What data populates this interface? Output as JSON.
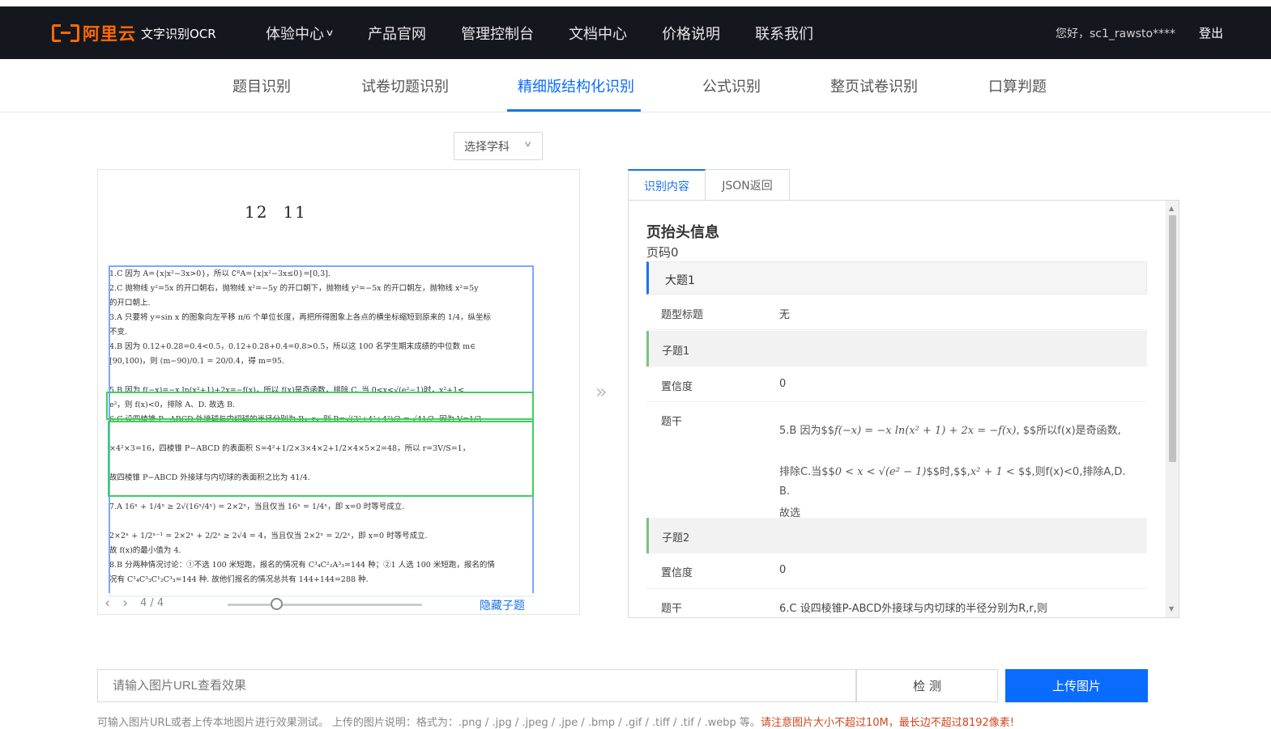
{
  "header": {
    "brand": "阿里云",
    "product": "文字识别OCR",
    "nav": [
      "体验中心",
      "产品官网",
      "管理控制台",
      "文档中心",
      "价格说明",
      "联系我们"
    ],
    "greeting": "您好，sc1_rawsto****",
    "logout": "登出"
  },
  "tabs": [
    "题目识别",
    "试卷切题识别",
    "精细版结构化识别",
    "公式识别",
    "整页试卷识别",
    "口算判题"
  ],
  "active_tab": "精细版结构化识别",
  "subject_select": "选择学科",
  "image_panel": {
    "page_title_left": "12",
    "page_title_right": "11",
    "doc_lines": [
      "1.C  因为 A={x|x²−3x>0}，所以 ∁ᴿA={x|x²−3x≤0}=[0,3].",
      "2.C  抛物线 y²=5x 的开口朝右，抛物线 x²=−5y 的开口朝下，抛物线 y²=−5x 的开口朝左，抛物线 x²=5y",
      "   的开口朝上.",
      "3.A  只要将 y=sin x 的图象向左平移 π/6 个单位长度，再把所得图象上各点的横坐标缩短到原来的 1/4，纵坐标",
      "   不变.",
      "4.B  因为 0.12+0.28=0.4<0.5，0.12+0.28+0.4=0.8>0.5，所以这 100 名学生期末成绩的中位数 m∈",
      "   [90,100)，则 (m−90)/0.1 = 20/0.4，得 m=95.",
      "",
      "5.B  因为 f(−x)=−x ln(x²+1)+2x=−f(x)，所以 f(x)是奇函数，排除 C. 当 0<x<√(e²−1)时，x²+1<",
      "   e²，则 f(x)<0，排除 A、D. 故选 B.",
      "6.C  设四棱锥 P−ABCD 外接球与内切球的半径分别为 R，r，则 R=√(3²+4²+4²)/2 = √41/2. 因为 V=1/3",
      "",
      "   ×4²×3=16，四棱锥 P−ABCD 的表面积 S=4²+1/2×3×4×2+1/2×4×5×2=48，所以 r=3V/S=1，",
      "",
      "   故四棱锥 P−ABCD 外接球与内切球的表面积之比为 41/4.",
      "",
      "7.A  16ˣ + 1/4ˣ ≥ 2√(16ˣ/4ˣ) = 2×2ˣ，当且仅当 16ˣ = 1/4ˣ，即 x=0 时等号成立.",
      "",
      "   2×2ˣ + 1/2ˣ⁻¹ = 2×2ˣ + 2/2ˣ ≥ 2√4 = 4，当且仅当 2×2ˣ = 2/2ˣ，即 x=0 时等号成立.",
      "   故 f(x)的最小值为 4.",
      "8.B  分两种情况讨论：①不选 100 米短跑，报名的情况有 C³₄C²₂A³₃=144 种；②1 人选 100 米短跑，报名的情",
      "   况有 C¹₄C³₃C¹₂C³₃=144 种. 故他们报名的情况总共有 144+144=288 种."
    ],
    "pager": "4 / 4",
    "hide_sub": "隐藏子题"
  },
  "result": {
    "tabs": [
      "识别内容",
      "JSON返回"
    ],
    "section_title": "页抬头信息",
    "page_no": "页码0",
    "big_question": "大题1",
    "type_title_label": "题型标题",
    "type_title_value": "无",
    "sub1": {
      "label": "子题1",
      "conf_label": "置信度",
      "conf_value": "0",
      "stem_label": "题干",
      "stem_line1_pre": "5.B 因为$$",
      "stem_line1_math": "f(−x) = −x ln(x² + 1) + 2x = −f(x)",
      "stem_line1_post": ", $$所以f(x)是奇函数,",
      "stem_line2_pre": "排除C.当$$",
      "stem_line2_math": "0 < x < √(e² − 1)",
      "stem_line2_mid": "$$时,$$,",
      "stem_line2_math2": "x² + 1 <",
      "stem_line2_post": " $$,则f(x)<0,排除A,D.故选",
      "stem_line3": "B."
    },
    "sub2": {
      "label": "子题2",
      "conf_label": "置信度",
      "conf_value": "0",
      "stem_label": "题干",
      "stem_text": "6.C 设四棱锥P-ABCD外接球与内切球的半径分别为R,r,则"
    }
  },
  "bottom": {
    "url_placeholder": "请输入图片URL查看效果",
    "detect": "检 测",
    "upload": "上传图片",
    "note": "可输入图片URL或者上传本地图片进行效果测试。 上传的图片说明：格式为：.png / .jpg / .jpeg / .jpe / .bmp / .gif / .tiff / .tif / .webp 等。",
    "warning": "请注意图片大小不超过10M，最长边不超过8192像素!"
  },
  "colors": {
    "header_bg": "#15171f",
    "brand": "#ff6a00",
    "accent": "#0a6cff",
    "box_blue": "#7ea6ff",
    "box_green": "#3fd05a",
    "warning": "#d3451b"
  }
}
